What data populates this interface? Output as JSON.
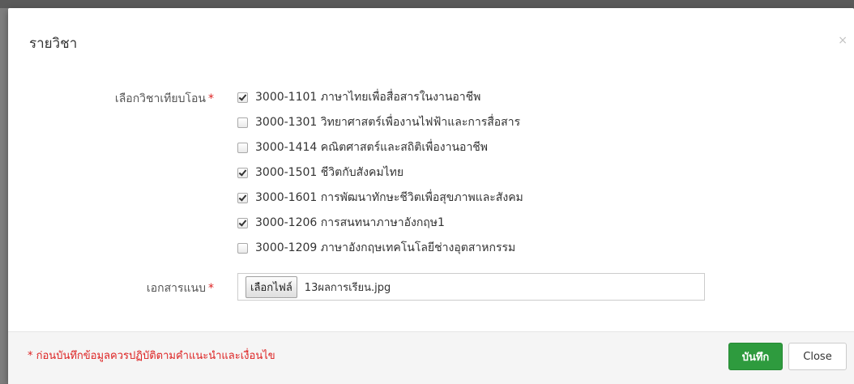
{
  "modal": {
    "title": "รายวิชา",
    "close_symbol": "×"
  },
  "form": {
    "subjects_label": "เลือกวิชาเทียบโอน",
    "required_mark": "*",
    "subjects": [
      {
        "label": "3000-1101 ภาษาไทยเพื่อสื่อสารในงานอาชีพ",
        "checked": true
      },
      {
        "label": "3000-1301 วิทยาศาสตร์เพื่องานไฟฟ้าและการสื่อสาร",
        "checked": false
      },
      {
        "label": "3000-1414 คณิตศาสตร์และสถิติเพื่องานอาชีพ",
        "checked": false
      },
      {
        "label": "3000-1501 ชีวิตกับสังคมไทย",
        "checked": true
      },
      {
        "label": "3000-1601 การพัฒนาทักษะชีวิตเพื่อสุขภาพและสังคม",
        "checked": true
      },
      {
        "label": "3000-1206 การสนทนาภาษาอังกฤษ1",
        "checked": true
      },
      {
        "label": "3000-1209 ภาษาอังกฤษเทคโนโลยีช่างอุตสาหกรรม",
        "checked": false
      }
    ],
    "attachment_label": "เอกสารแนบ",
    "file_button": "เลือกไฟล์",
    "file_name": "13ผลการเรียน.jpg"
  },
  "footer": {
    "note": "* ก่อนบันทึกข้อมูลควรปฏิบัติตามคำแนะนำและเงื่อนไข",
    "save_label": "บันทึก",
    "close_label": "Close"
  },
  "colors": {
    "save_button": "#2e9b3e",
    "required": "#dd2222"
  }
}
